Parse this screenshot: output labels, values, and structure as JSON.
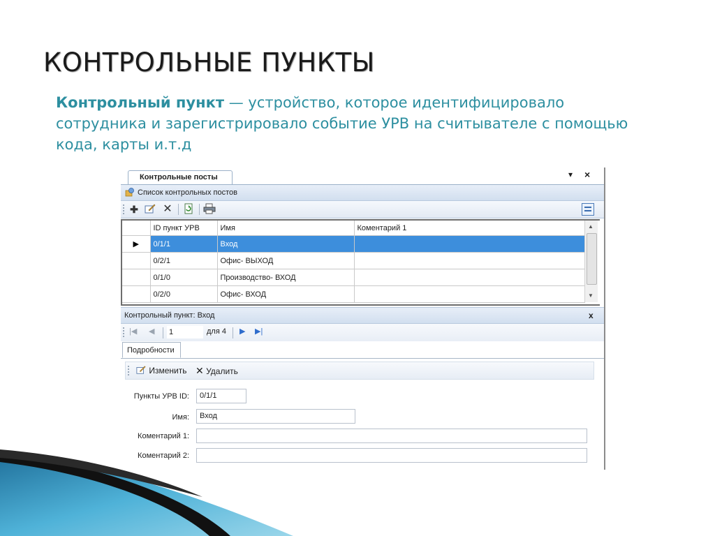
{
  "slide": {
    "title": "КОНТРОЛЬНЫЕ ПУНКТЫ",
    "description_term": "Контрольный пункт",
    "description_rest": " — устройство, которое идентифицировало сотрудника и зарегистрировало событие УРВ на считывателе с помощью кода, карты и.т.д"
  },
  "panel": {
    "tab_title": "Контрольные посты",
    "pin_icon": "▾",
    "close_icon": "×"
  },
  "list": {
    "header_title": "Список контрольных постов",
    "columns": [
      "ID пункт УРВ",
      "Имя",
      "Коментарий 1"
    ],
    "rows": [
      {
        "id": "0/1/1",
        "name": "Вход",
        "comment": ""
      },
      {
        "id": "0/2/1",
        "name": "Офис- ВЫХОД",
        "comment": ""
      },
      {
        "id": "0/1/0",
        "name": "Производство- ВХОД",
        "comment": ""
      },
      {
        "id": "0/2/0",
        "name": "Офис- ВХОД",
        "comment": ""
      }
    ],
    "selected_row": 0
  },
  "detail": {
    "header_title": "Контрольный пункт: Вход",
    "close_label": "x",
    "nav_position": "1",
    "nav_of": "для 4",
    "tab_label": "Подробности",
    "edit_label": "Изменить",
    "delete_label": "Удалить",
    "fields": {
      "id_label": "Пункты УРВ ID:",
      "id_value": "0/1/1",
      "name_label": "Имя:",
      "name_value": "Вход",
      "comment1_label": "Коментарий 1:",
      "comment1_value": "",
      "comment2_label": "Коментарий 2:",
      "comment2_value": ""
    }
  },
  "colors": {
    "accent_text": "#2d8fa0",
    "selected_row": "#3d8edc",
    "header_gradient": "#d2dfef"
  }
}
